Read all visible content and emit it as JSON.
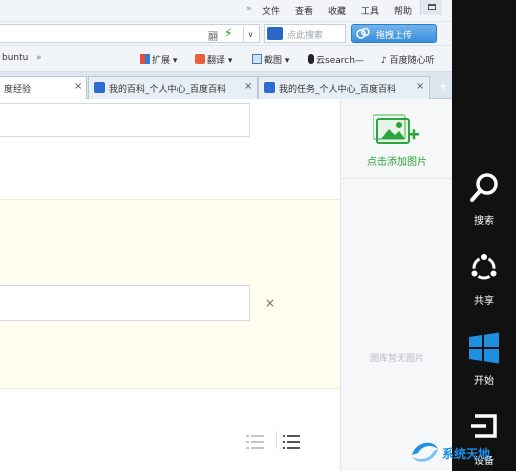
{
  "menu": {
    "chevron": "»",
    "items": [
      "文件",
      "查看",
      "收藏",
      "工具",
      "帮助"
    ]
  },
  "address_bar": {
    "search_placeholder": "点此搜索",
    "upload_label": "拖拽上传",
    "dropdown_glyph": "∨"
  },
  "bookmarks": {
    "items": [
      "buntu",
      "»",
      "扩展",
      "翻译",
      "截图",
      "云search—",
      "百度随心听"
    ]
  },
  "tabs": [
    {
      "title": "度经验",
      "active": true
    },
    {
      "title": "我的百科_个人中心_百度百科",
      "active": false
    },
    {
      "title": "我的任务_个人中心_百度百科",
      "active": false
    }
  ],
  "tab_close_glyph": "×",
  "tab_new_glyph": "+",
  "content": {
    "clear_glyph": "×",
    "add_image_label": "点击添加图片",
    "no_image_label": "图库暂无图片"
  },
  "charms": [
    {
      "label": "搜索",
      "icon": "search-icon"
    },
    {
      "label": "共享",
      "icon": "share-icon"
    },
    {
      "label": "开始",
      "icon": "windows-start-icon"
    },
    {
      "label": "设备",
      "icon": "devices-icon"
    }
  ],
  "watermark": {
    "text": "系统天地"
  },
  "colors": {
    "accent_blue": "#3a8edb",
    "add_image_green": "#2aa63a",
    "charms_bg": "#111111",
    "start_blue": "#1e90e0"
  }
}
